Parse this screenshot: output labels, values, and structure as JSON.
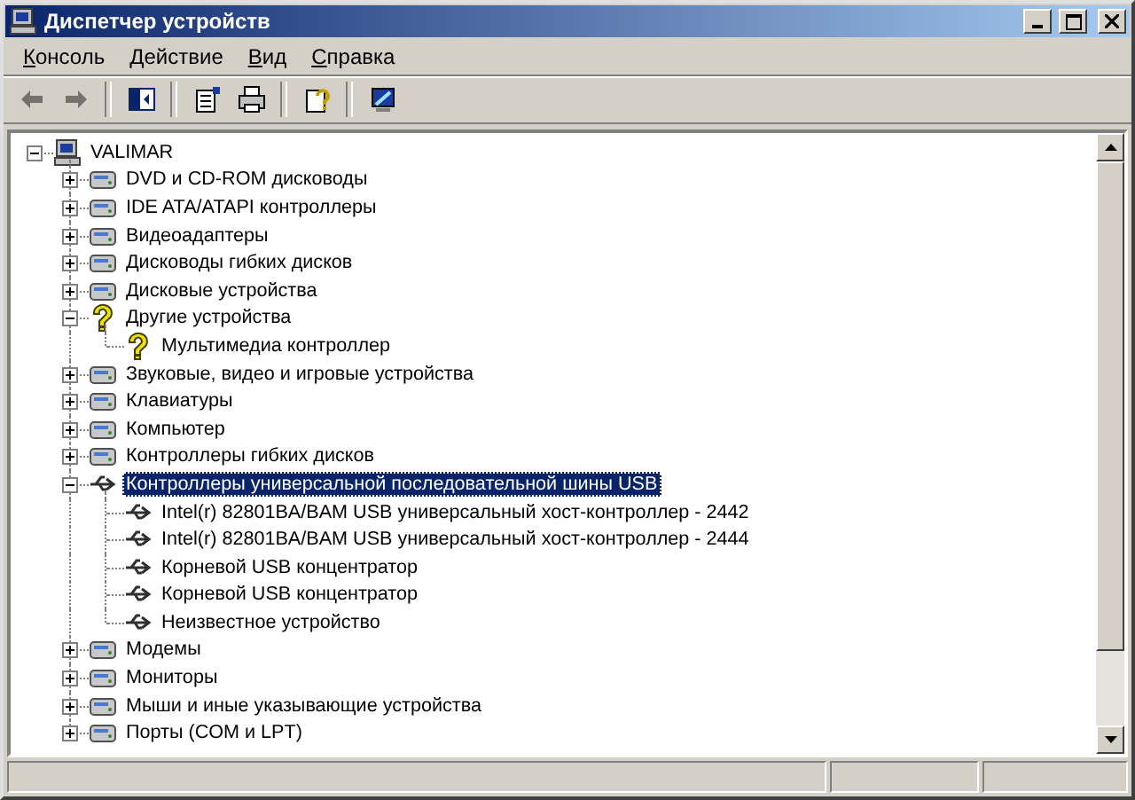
{
  "window": {
    "title": "Диспетчер устройств"
  },
  "menu": [
    {
      "label": "Консоль"
    },
    {
      "label": "Действие"
    },
    {
      "label": "Вид"
    },
    {
      "label": "Справка"
    }
  ],
  "toolbar": [
    {
      "kind": "back",
      "disabled": true
    },
    {
      "kind": "forward",
      "disabled": true
    },
    {
      "kind": "separator"
    },
    {
      "kind": "tree",
      "disabled": false
    },
    {
      "kind": "separator"
    },
    {
      "kind": "properties",
      "disabled": false
    },
    {
      "kind": "print",
      "disabled": false
    },
    {
      "kind": "separator"
    },
    {
      "kind": "help",
      "disabled": false
    },
    {
      "kind": "separator"
    },
    {
      "kind": "scan",
      "disabled": false
    }
  ],
  "tree": [
    {
      "label": "VALIMAR",
      "kind": "computer",
      "expanded": true,
      "selected": false,
      "children": [
        {
          "label": "DVD и CD-ROM дисководы",
          "kind": "device",
          "expanded": false,
          "selected": false
        },
        {
          "label": "IDE ATA/ATAPI контроллеры",
          "kind": "device",
          "expanded": false,
          "selected": false
        },
        {
          "label": "Видеоадаптеры",
          "kind": "device",
          "expanded": false,
          "selected": false
        },
        {
          "label": "Дисководы гибких дисков",
          "kind": "device",
          "expanded": false,
          "selected": false
        },
        {
          "label": "Дисковые устройства",
          "kind": "device",
          "expanded": false,
          "selected": false
        },
        {
          "label": "Другие устройства",
          "kind": "unknown",
          "expanded": true,
          "selected": false,
          "children": [
            {
              "label": "Мультимедиа контроллер",
              "kind": "unknown",
              "selected": false
            }
          ]
        },
        {
          "label": "Звуковые, видео и игровые устройства",
          "kind": "device",
          "expanded": false,
          "selected": false
        },
        {
          "label": "Клавиатуры",
          "kind": "device",
          "expanded": false,
          "selected": false
        },
        {
          "label": "Компьютер",
          "kind": "device",
          "expanded": false,
          "selected": false
        },
        {
          "label": "Контроллеры гибких дисков",
          "kind": "device",
          "expanded": false,
          "selected": false
        },
        {
          "label": "Контроллеры универсальной последовательной шины USB",
          "kind": "usb",
          "expanded": true,
          "selected": true,
          "children": [
            {
              "label": "Intel(r) 82801BA/BAM USB универсальный хост-контроллер - 2442",
              "kind": "usb",
              "selected": false
            },
            {
              "label": "Intel(r) 82801BA/BAM USB универсальный хост-контроллер - 2444",
              "kind": "usb",
              "selected": false
            },
            {
              "label": "Корневой USB концентратор",
              "kind": "usb",
              "selected": false
            },
            {
              "label": "Корневой USB концентратор",
              "kind": "usb",
              "selected": false
            },
            {
              "label": "Неизвестное устройство",
              "kind": "usb",
              "selected": false
            }
          ]
        },
        {
          "label": "Модемы",
          "kind": "device",
          "expanded": false,
          "selected": false
        },
        {
          "label": "Мониторы",
          "kind": "device",
          "expanded": false,
          "selected": false
        },
        {
          "label": "Мыши и иные указывающие устройства",
          "kind": "device",
          "expanded": false,
          "selected": false
        },
        {
          "label": "Порты (COM и LPT)",
          "kind": "device",
          "expanded": false,
          "selected": false
        }
      ]
    }
  ]
}
